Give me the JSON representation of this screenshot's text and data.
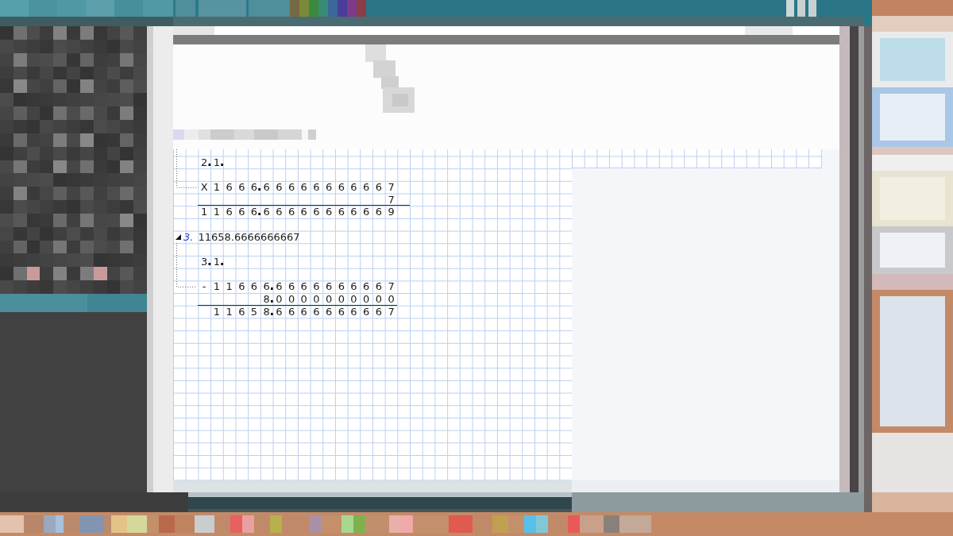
{
  "worksheet": {
    "steps": [
      {
        "label": "2.1.",
        "operator": "X",
        "operands": [
          "1 6 6 6.6 6 6 6 6 6 6 6 6 6 7",
          "7"
        ],
        "result": "1 1 6 6 6.6 6 6 6 6 6 6 6 6 6 9"
      },
      {
        "number": "3.",
        "value": "11658.6666666667",
        "expanded": true,
        "label": "3.1.",
        "operator": "-",
        "operands": [
          "1 1 6 6 6.6 6 6 6 6 6 6 6 6 7",
          "8.0 0 0 0 0 0 0 0 0 0"
        ],
        "result": "1 1 6 5 8.6 6 6 6 6 6 6 6 6 7"
      }
    ]
  }
}
